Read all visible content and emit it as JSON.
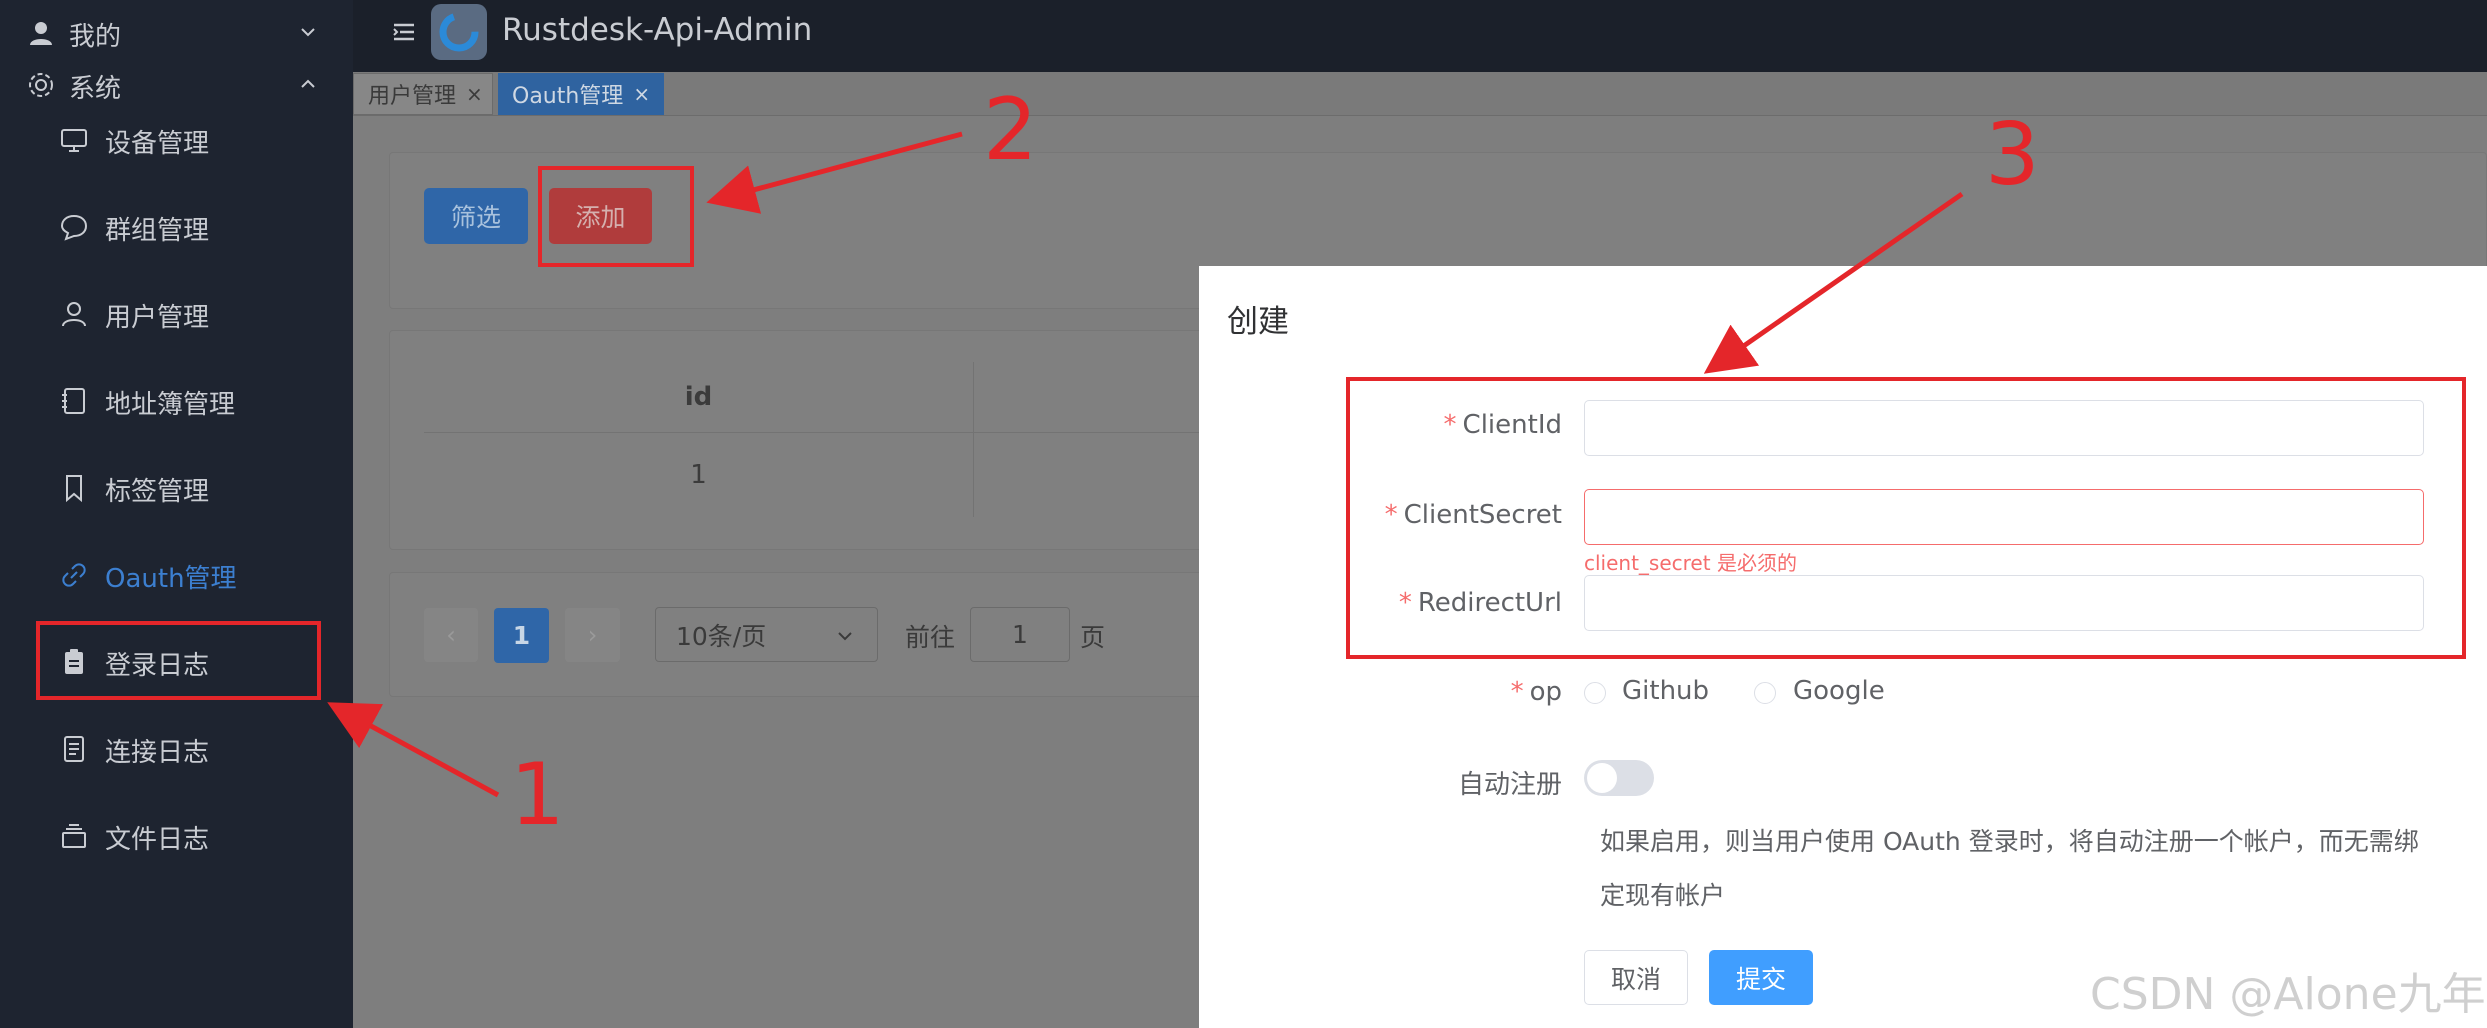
{
  "sidebar": {
    "group_mine": "我的",
    "group_system": "系统",
    "items": [
      {
        "label": "设备管理",
        "icon": "monitor-icon"
      },
      {
        "label": "群组管理",
        "icon": "chat-bubble-icon"
      },
      {
        "label": "用户管理",
        "icon": "user-icon"
      },
      {
        "label": "地址簿管理",
        "icon": "address-book-icon"
      },
      {
        "label": "标签管理",
        "icon": "bookmark-icon"
      },
      {
        "label": "Oauth管理",
        "icon": "link-icon",
        "active": true
      },
      {
        "label": "登录日志",
        "icon": "clipboard-icon"
      },
      {
        "label": "连接日志",
        "icon": "document-icon"
      },
      {
        "label": "文件日志",
        "icon": "box-icon"
      }
    ]
  },
  "header": {
    "title": "Rustdesk-Api-Admin"
  },
  "tabs": [
    {
      "label": "用户管理",
      "close": "×"
    },
    {
      "label": "Oauth管理",
      "close": "×"
    }
  ],
  "toolbar": {
    "filter_label": "筛选",
    "add_label": "添加"
  },
  "table": {
    "columns": [
      "id"
    ],
    "rows": [
      [
        "1"
      ]
    ]
  },
  "pagination": {
    "prev": "‹",
    "current_page": "1",
    "next": "›",
    "page_size": "10条/页",
    "goto_label": "前往",
    "goto_value": "1",
    "page_suffix": "页"
  },
  "dialog": {
    "title": "创建",
    "required_mark": "*",
    "client_id_label": "ClientId",
    "client_secret_label": "ClientSecret",
    "client_secret_error": "client_secret 是必须的",
    "redirect_url_label": "RedirectUrl",
    "op_label": "op",
    "op_options": [
      "Github",
      "Google"
    ],
    "auto_register_label": "自动注册",
    "auto_register_on": false,
    "auto_register_help": "如果启用，则当用户使用 OAuth 登录时，将自动注册一个帐户，而无需绑定现有帐户",
    "cancel_label": "取消",
    "submit_label": "提交"
  },
  "annotations": {
    "n1": "1",
    "n2": "2",
    "n3": "3",
    "color": "#e4262a"
  },
  "watermark": "CSDN @Alone九年"
}
